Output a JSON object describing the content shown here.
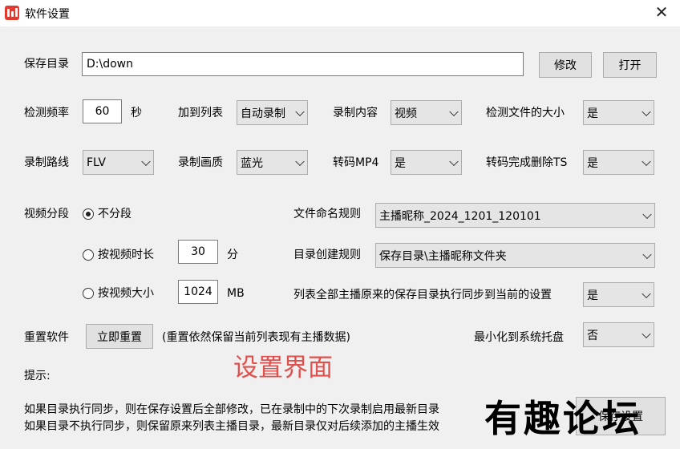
{
  "window": {
    "title": "软件设置",
    "close_glyph": "✕"
  },
  "save_dir": {
    "label": "保存目录",
    "value": "D:\\down",
    "modify_label": "修改",
    "open_label": "打开"
  },
  "row1": {
    "freq_label": "检测频率",
    "freq_value": "60",
    "freq_unit": "秒",
    "add_list_label": "加到列表",
    "add_list_value": "自动录制",
    "content_label": "录制内容",
    "content_value": "视频",
    "check_size_label": "检测文件的大小",
    "check_size_value": "是"
  },
  "row2": {
    "route_label": "录制路线",
    "route_value": "FLV",
    "quality_label": "录制画质",
    "quality_value": "蓝光",
    "mp4_label": "转码MP4",
    "mp4_value": "是",
    "delete_ts_label": "转码完成删除TS",
    "delete_ts_value": "是"
  },
  "segment": {
    "label": "视频分段",
    "none_label": "不分段",
    "by_duration_label": "按视频时长",
    "duration_value": "30",
    "duration_unit": "分",
    "by_size_label": "按视频大小",
    "size_value": "1024",
    "size_unit": "MB",
    "selected": "none"
  },
  "naming": {
    "label": "文件命名规则",
    "value": "主播昵称_2024_1201_120101"
  },
  "dir_rule": {
    "label": "目录创建规则",
    "value": "保存目录\\主播昵称文件夹"
  },
  "sync": {
    "label": "列表全部主播原来的保存目录执行同步到当前的设置",
    "value": "是"
  },
  "reset": {
    "label": "重置软件",
    "button_label": "立即重置",
    "note": "(重置依然保留当前列表现有主播数据)"
  },
  "minimize": {
    "label": "最小化到系统托盘",
    "value": "否"
  },
  "overlay_caption": "设置界面",
  "tips": {
    "title": "提示:",
    "line1": "如果目录执行同步，则在保存设置后全部修改，已在录制中的下次录制启用最新目录",
    "line2": "如果目录不执行同步，则保留原来列表主播目录，最新目录仅对后续添加的主播生效"
  },
  "save_button_label": "保存设置",
  "forum_mark": "有趣论坛",
  "colors": {
    "app_icon": "#e23a2e",
    "overlay_caption": "#e0504c"
  }
}
